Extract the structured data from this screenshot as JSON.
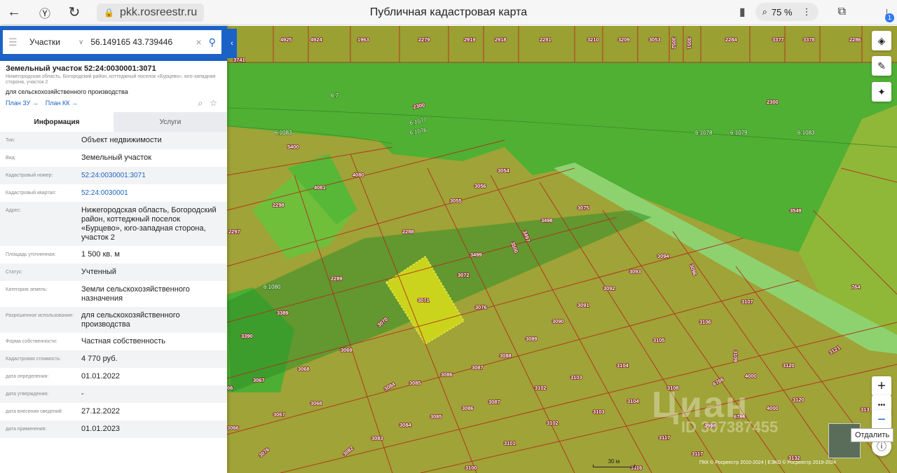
{
  "browser": {
    "url": "pkk.rosreestr.ru",
    "title": "Публичная кадастровая карта",
    "zoom": "75 %",
    "downloads_count": "1"
  },
  "search": {
    "type": "Участки",
    "value": "56.149165 43.739446"
  },
  "object": {
    "title": "Земельный участок 52:24:0030001:3071",
    "address_small": "Нижегородская область, Богородский район, коттеджный поселок «Бурцево», юго-западная сторона, участок 2",
    "purpose": "для сельскохозяйственного производства",
    "link_zu": "План ЗУ →",
    "link_kk": "План КК →"
  },
  "tabs": {
    "info": "Информация",
    "services": "Услуги"
  },
  "fields": [
    {
      "k": "Тип:",
      "v": "Объект недвижимости"
    },
    {
      "k": "Вид:",
      "v": "Земельный участок"
    },
    {
      "k": "Кадастровый номер:",
      "v": "52:24:0030001:3071"
    },
    {
      "k": "Кадастровый квартал:",
      "v": "52:24:0030001"
    },
    {
      "k": "Адрес:",
      "v": "Нижегородская область, Богородский район, коттеджный поселок «Бурцево», юго-западная сторона, участок 2"
    },
    {
      "k": "Площадь уточненная:",
      "v": "1 500 кв. м"
    },
    {
      "k": "Статус:",
      "v": "Учтенный"
    },
    {
      "k": "Категория земель:",
      "v": "Земли сельскохозяйственного назначения"
    },
    {
      "k": "Разрешенное использование:",
      "v": "для сельскохозяйственного производства"
    },
    {
      "k": "Форма собственности:",
      "v": "Частная собственность"
    },
    {
      "k": "Кадастровая стоимость:",
      "v": "4 770 руб."
    },
    {
      "k": "дата определения:",
      "v": "01.01.2022"
    },
    {
      "k": "дата утверждения:",
      "v": "-"
    },
    {
      "k": "дата внесения сведений:",
      "v": "27.12.2022"
    },
    {
      "k": "дата применения:",
      "v": "01.01.2023"
    }
  ],
  "map": {
    "tooltip": "Отдалить",
    "scale_label": "30 м",
    "copyright": "ПКК © Росреестр 2010-2024 | ЕЭКО © Росреестр 2019-2024",
    "watermark": "Циан",
    "watermark_id": "ID 307387455",
    "top_labels": [
      "4925",
      "4924",
      "1963",
      "2279",
      "2919",
      "2918",
      "2281",
      "3210",
      "3209",
      "3053",
      "3052",
      "3051",
      "2284",
      "3377",
      "3378",
      "2286"
    ],
    "parcel_labels": [
      "3741",
      "6.7",
      "2300",
      "6.1077",
      "6.1076",
      "2300",
      "6.1078",
      "6.1079",
      "6.1083",
      "6.1083",
      "5400",
      "4080",
      "4081",
      "3054",
      "3056",
      "3055",
      "2298",
      "2288",
      "3075",
      "3498",
      "3497",
      "3500",
      "3499",
      "3549",
      "2297",
      "3072",
      "3071",
      "3094",
      "3093",
      "3092",
      "3096",
      "2289",
      "6.1080",
      "764",
      "3076",
      "3091",
      "3107",
      "3106",
      "3389",
      "3070",
      "3090",
      "3089",
      "3105",
      "3390",
      "3069",
      "3088",
      "3104",
      "3103",
      "3109",
      "3121",
      "3120",
      "3068",
      "3067",
      "3087",
      "3086",
      "3085",
      "3084",
      "3102",
      "3108",
      "6766",
      "4000",
      "4000",
      "3120",
      "3068",
      "3067",
      "3086",
      "3087",
      "3085",
      "3084",
      "3083",
      "3082",
      "3101",
      "3102",
      "3103",
      "3104",
      "3117",
      "3117",
      "3998",
      "6766",
      "3132",
      "3100",
      "3116",
      "3076",
      "3066",
      "66",
      "313"
    ]
  }
}
